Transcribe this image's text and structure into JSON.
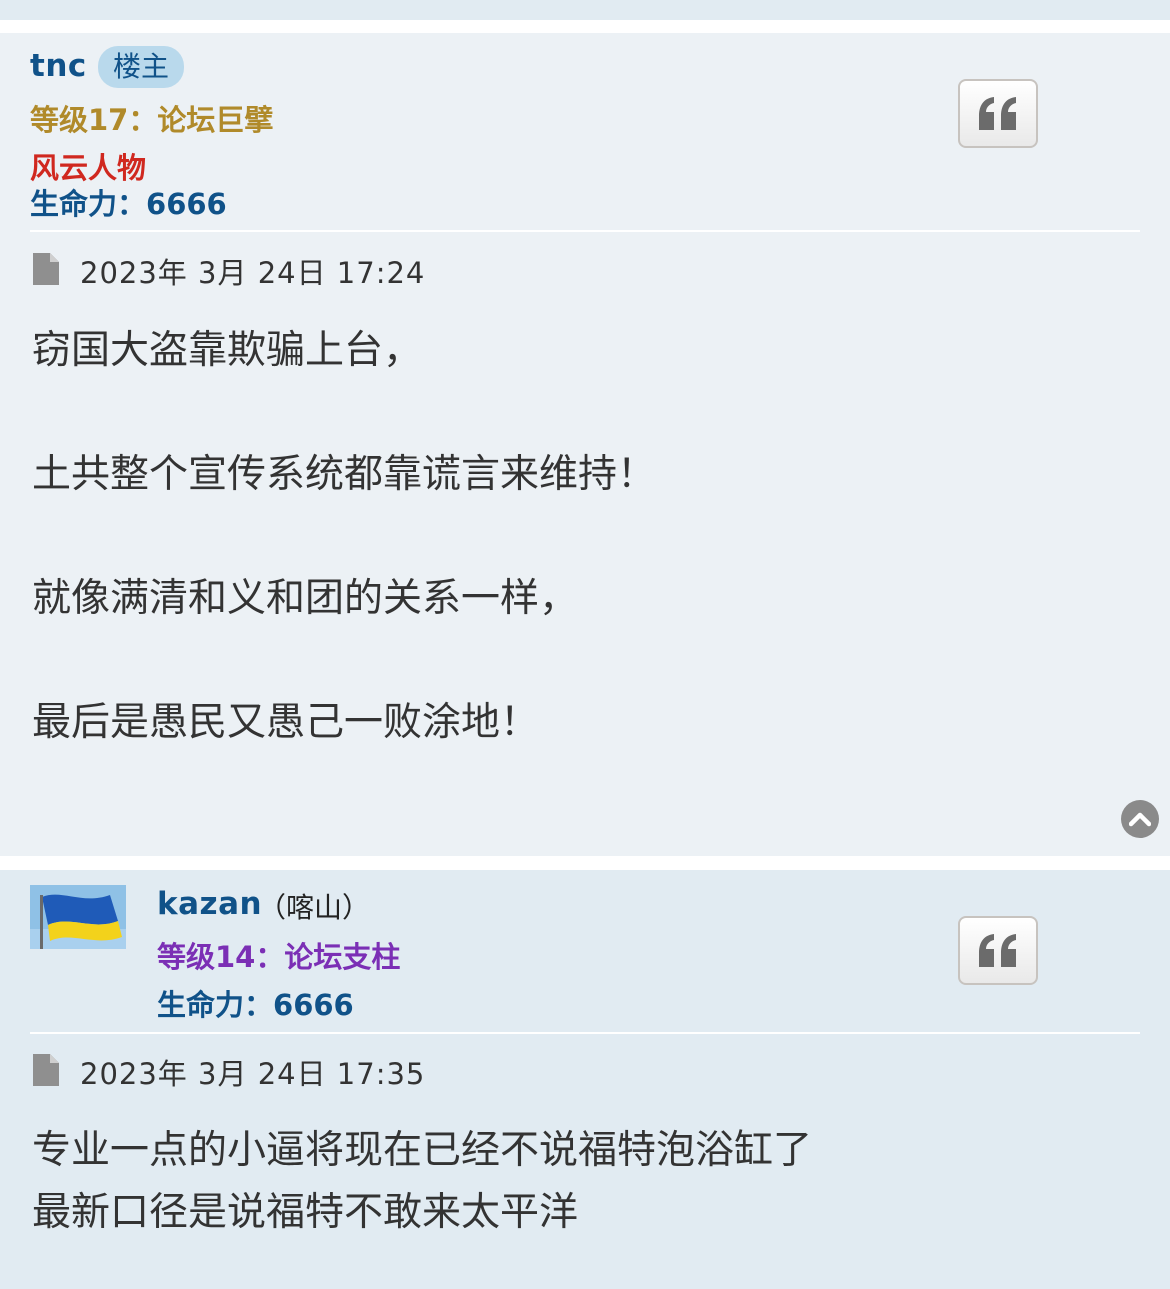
{
  "posts": [
    {
      "author": "tnc",
      "badge": "楼主",
      "rank_label": "等级17：论坛巨擘",
      "special_rank": "风云人物",
      "vitality_label": "生命力：",
      "vitality_value": "6666",
      "timestamp": "2023年 3月 24日 17:24",
      "content": [
        "窃国大盗靠欺骗上台，",
        "",
        "土共整个宣传系统都靠谎言来维持！",
        "",
        "就像满清和义和团的关系一样，",
        "",
        "最后是愚民又愚己一败涂地！"
      ]
    },
    {
      "author": "kazan",
      "author_suffix": "（喀山）",
      "rank_label": "等级14：论坛支柱",
      "vitality_label": "生命力：",
      "vitality_value": "6666",
      "timestamp": "2023年 3月 24日 17:35",
      "content": [
        "专业一点的小逼将现在已经不说福特泡浴缸了",
        "最新口径是说福特不敢来太平洋"
      ]
    }
  ],
  "icons": {
    "quote": "quote-icon",
    "document": "document-icon",
    "back_to_top": "chevron-up-icon",
    "avatar": "ukraine-flag"
  },
  "colors": {
    "post_bg_1": "#ecf1f5",
    "post_bg_2": "#e1ebf2",
    "username": "#105289",
    "rank_17": "#b08a2a",
    "rank_14": "#7b2fb5",
    "special_rank": "#d0281f"
  }
}
